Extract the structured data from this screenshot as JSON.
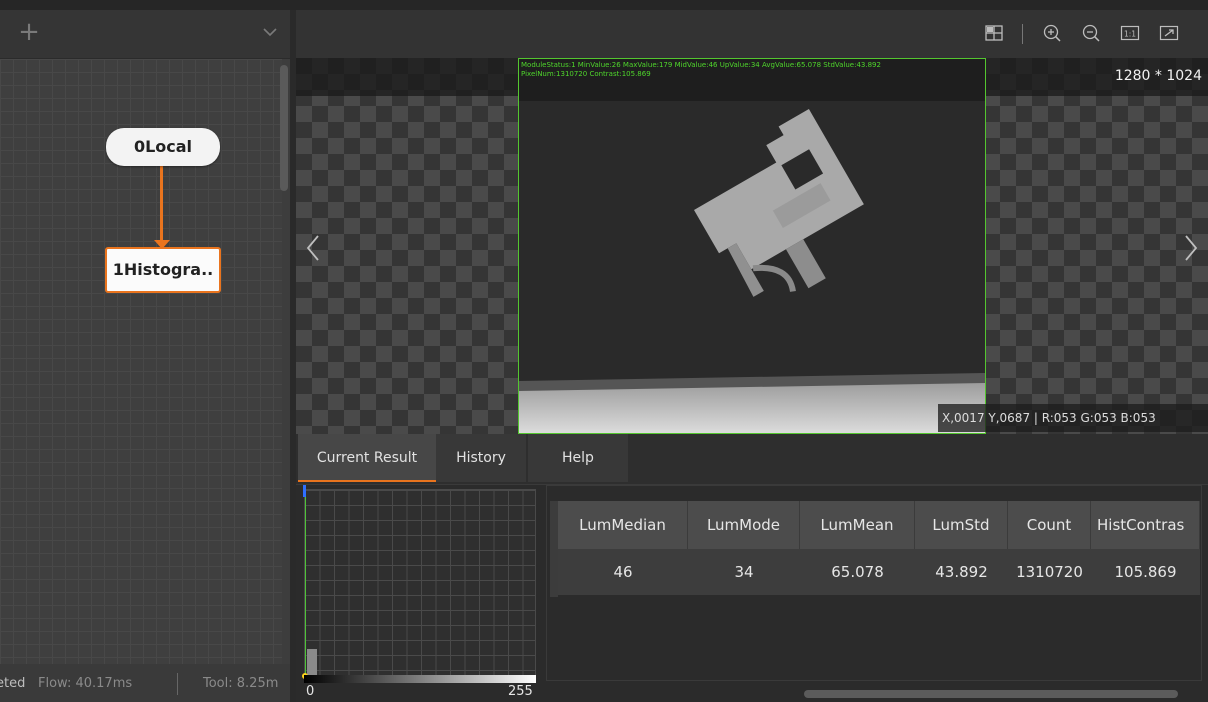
{
  "flow_panel": {
    "add_label": "+",
    "nodes": [
      {
        "label": "0Local"
      },
      {
        "label": "1Histogra.."
      }
    ],
    "status": {
      "state": "eted",
      "flow": "Flow: 40.17ms",
      "tool": "Tool: 8.25m"
    }
  },
  "image_view": {
    "overlay_line1": "ModuleStatus:1 MinValue:26 MaxValue:179 MidValue:46 UpValue:34 AvgValue:65.078 StdValue:43.892",
    "overlay_line2": "PixelNum:1310720 Contrast:105.869",
    "dimensions": "1280 * 1024",
    "coordinates": "X,0017  Y,0687  |  R:053  G:053  B:053",
    "toolbar_icons": [
      "grid-icon",
      "zoom-in-icon",
      "zoom-out-icon",
      "actual-size-icon",
      "fit-window-icon"
    ],
    "toolbar_actual_size_label": "1:1"
  },
  "tabs": [
    {
      "label": "Current Result",
      "active": true
    },
    {
      "label": "History",
      "active": false
    },
    {
      "label": "Help",
      "active": false
    }
  ],
  "histogram": {
    "x_min_label": "0",
    "x_max_label": "255"
  },
  "results_table": {
    "columns": [
      "LumMedian",
      "LumMode",
      "LumMean",
      "LumStd",
      "Count",
      "HistContras"
    ],
    "rows": [
      [
        "46",
        "34",
        "65.078",
        "43.892",
        "1310720",
        "105.869"
      ]
    ]
  },
  "colors": {
    "accent": "#e9741e",
    "roi": "#54c62f",
    "overlay_text": "#4fd62c"
  }
}
